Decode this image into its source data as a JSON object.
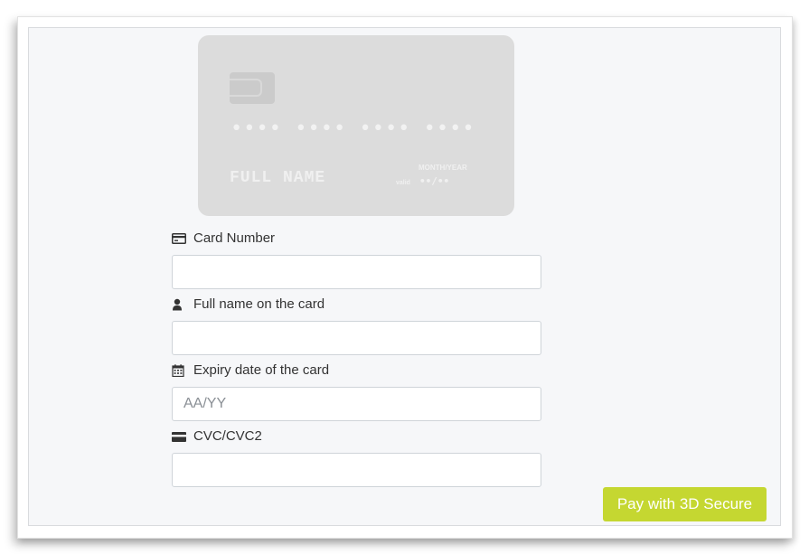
{
  "card_preview": {
    "number": "•••• •••• •••• ••••",
    "name": "FULL NAME",
    "expiry_label": "MONTH/YEAR",
    "valid_label": "valid",
    "expiry_value": "••/••"
  },
  "form": {
    "card_number": {
      "label": "Card Number",
      "icon": "credit-card-icon",
      "value": "",
      "placeholder": ""
    },
    "full_name": {
      "label": "Full name on the card",
      "icon": "user-icon",
      "value": "",
      "placeholder": ""
    },
    "expiry": {
      "label": "Expiry date of the card",
      "icon": "calendar-icon",
      "value": "",
      "placeholder": "AA/YY"
    },
    "cvc": {
      "label": "CVC/CVC2",
      "icon": "card-back-icon",
      "value": "",
      "placeholder": ""
    }
  },
  "pay_button": {
    "label": "Pay with 3D Secure"
  },
  "colors": {
    "accent": "#c5d731",
    "card_bg": "#dcdcdc",
    "panel_bg": "#f6f7f9"
  }
}
